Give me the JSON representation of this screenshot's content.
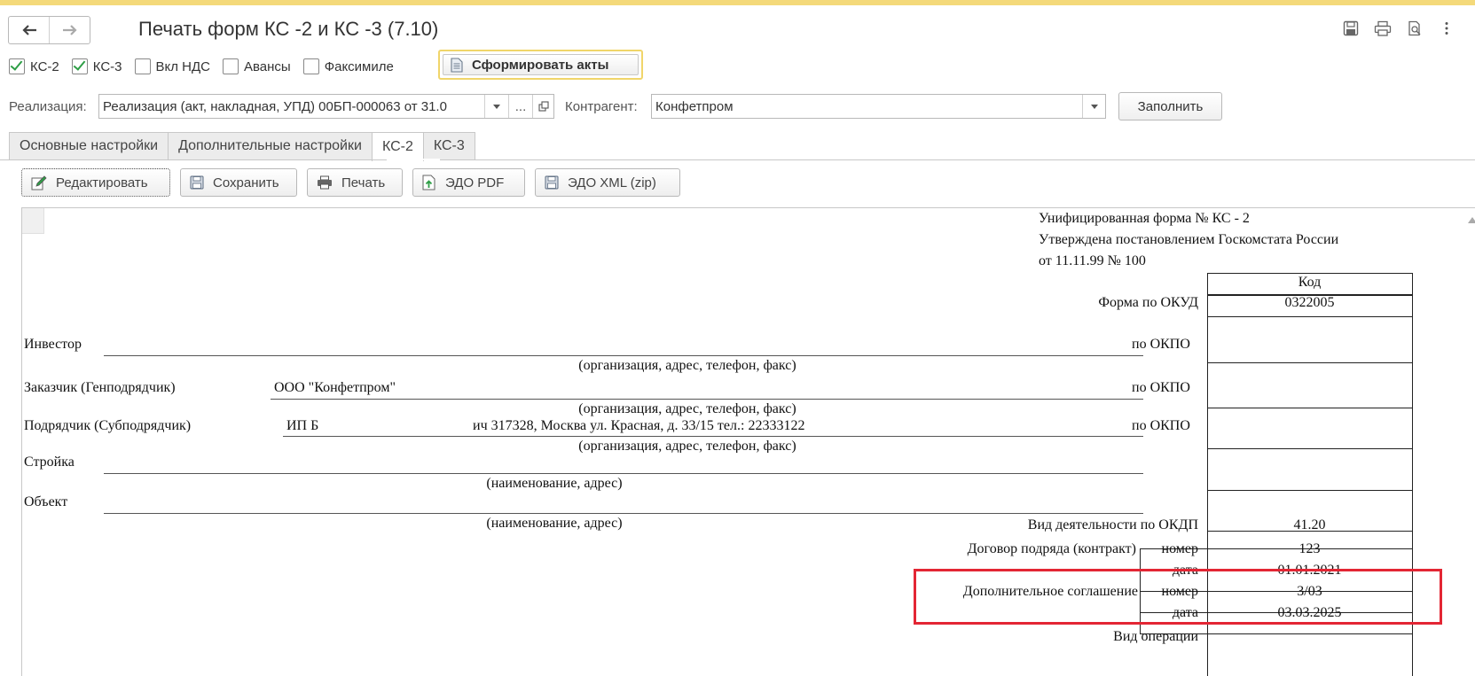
{
  "window": {
    "title": "Печать форм КС -2 и КС -3 (7.10)"
  },
  "icons": {
    "back": "arrow-left-icon",
    "forward": "arrow-right-icon",
    "save": "floppy-disk-icon",
    "print": "printer-icon",
    "preview": "print-preview-icon",
    "more": "kebab-menu-icon",
    "document": "document-icon",
    "edit": "pencil-icon",
    "export": "export-arrow-icon"
  },
  "options": {
    "ks2": {
      "label": "КС-2",
      "checked": true
    },
    "ks3": {
      "label": "КС-3",
      "checked": true
    },
    "vat": {
      "label": "Вкл НДС",
      "checked": false
    },
    "advances": {
      "label": "Авансы",
      "checked": false
    },
    "facsimile": {
      "label": "Факсимиле",
      "checked": false
    }
  },
  "actions": {
    "generate": "Сформировать акты",
    "fill": "Заполнить"
  },
  "filters": {
    "sale_label": "Реализация:",
    "sale_value": "Реализация (акт, накладная, УПД) 00БП-000063 от 31.0",
    "sale_ellipsis": "...",
    "counterparty_label": "Контрагент:",
    "counterparty_value": "Конфетпром"
  },
  "tabs": [
    {
      "label": "Основные настройки",
      "active": false
    },
    {
      "label": "Дополнительные настройки",
      "active": false
    },
    {
      "label": "КС-2",
      "active": true
    },
    {
      "label": "КС-3",
      "active": false
    }
  ],
  "toolbar": {
    "edit": "Редактировать",
    "save": "Сохранить",
    "print": "Печать",
    "edo_pdf": "ЭДО PDF",
    "edo_xml": "ЭДО XML (zip)"
  },
  "form": {
    "header": {
      "line1": "Унифицированная форма № КС - 2",
      "line2": "Утверждена постановлением Госкомстата России",
      "line3": "от 11.11.99 № 100"
    },
    "code_header": "Код",
    "okud_label": "Форма по ОКУД",
    "okud_value": "0322005",
    "investor_label": "Инвестор",
    "customer_label": "Заказчик (Генподрядчик)",
    "customer_value": "ООО \"Конфетпром\"",
    "contractor_label": "Подрядчик (Субподрядчик)",
    "contractor_value_start": "ИП Б",
    "contractor_value_end": "ич  317328, Москва ул. Красная, д. 33/15  тел.: 22333122",
    "org_hint": "(организация, адрес, телефон, факс)",
    "okpo_label": "по ОКПО",
    "site_label": "Стройка",
    "object_label": "Объект",
    "name_hint": "(наименование, адрес)",
    "okdp_label": "Вид деятельности по ОКДП",
    "okdp_value": "41.20",
    "contract_label": "Договор подряда (контракт)",
    "number_label": "номер",
    "date_label": "дата",
    "contract_number": "123",
    "contract_date": "01.01.2021",
    "supplement_label": "Дополнительное соглашение",
    "supplement_number": "3/03",
    "supplement_date": "03.03.2025",
    "operation_label": "Вид операции"
  },
  "colors": {
    "highlight": "#e32634",
    "check": "#2e9e46",
    "default_button_border": "#f0d56a"
  }
}
